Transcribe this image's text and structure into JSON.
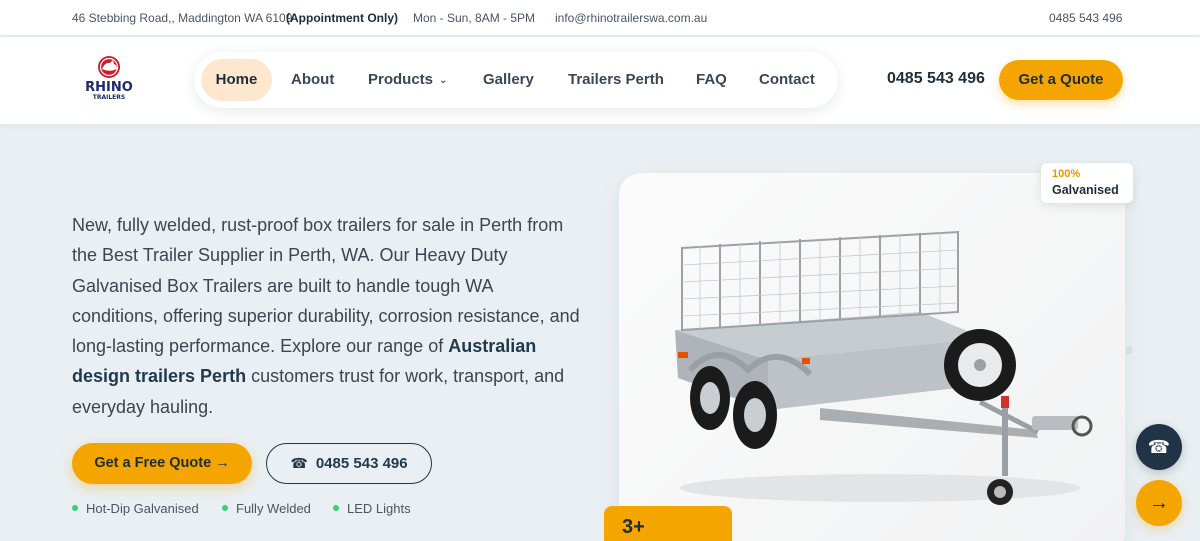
{
  "topbar": {
    "address": "46 Stebbing Road,, Maddington WA 6109",
    "appointment": "(Appointment Only)",
    "hours": "Mon - Sun, 8AM - 5PM",
    "email": "info@rhinotrailerswa.com.au",
    "phone": "0485 543 496"
  },
  "header": {
    "logo": {
      "line1": "RHINO",
      "line2": "TRAILERS"
    },
    "nav": [
      {
        "label": "Home",
        "active": true
      },
      {
        "label": "About"
      },
      {
        "label": "Products",
        "has_dropdown": true
      },
      {
        "label": "Gallery"
      },
      {
        "label": "Trailers Perth"
      },
      {
        "label": "FAQ"
      },
      {
        "label": "Contact"
      }
    ],
    "phone": "0485 543 496",
    "cta": "Get a Quote"
  },
  "hero": {
    "text_before": "New, fully welded, rust-proof box trailers for sale in Perth from the Best Trailer Supplier in Perth, WA. Our Heavy Duty Galvanised Box Trailers are built to handle tough WA conditions, offering superior durability, corrosion resistance, and long-lasting performance. Explore our range of ",
    "text_bold": "Australian design trailers Perth",
    "text_after": " customers trust for work, transport, and everyday hauling.",
    "btn_quote": "Get a Free Quote",
    "btn_quote_icon": "arrow-right-icon",
    "btn_phone": "0485 543 496",
    "btn_phone_icon": "phone-icon",
    "features": [
      "Hot-Dip Galvanised",
      "Fully Welded",
      "LED Lights"
    ]
  },
  "image_card": {
    "badge_pct": "100%",
    "badge_label": "Galvanised",
    "years_badge": "3+"
  },
  "colors": {
    "accent": "#f5a500",
    "navy": "#1f3a4d",
    "feature_dot": "#3ecf6e",
    "nav_active_bg": "#fde8cf"
  }
}
